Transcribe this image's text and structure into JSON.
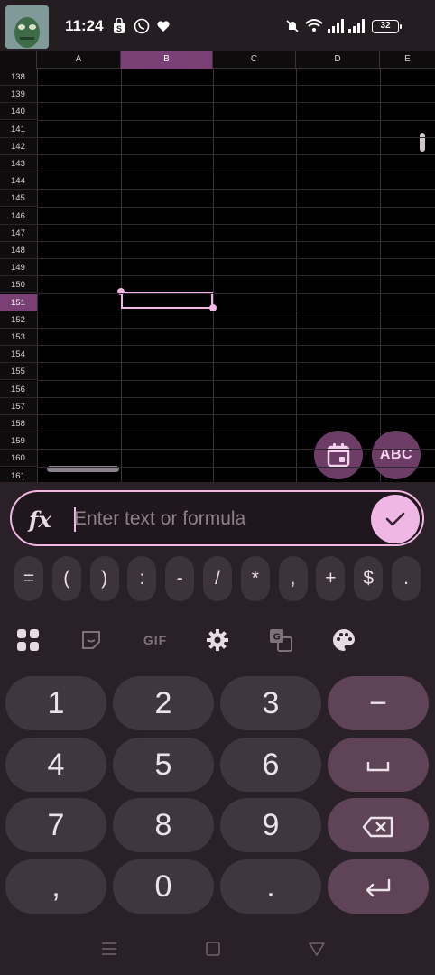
{
  "status_bar": {
    "time": "11:24",
    "battery": "32",
    "left_icons": [
      "shopping-bag-icon",
      "whatsapp-icon",
      "heart-shield-icon"
    ],
    "right_icons": [
      "mute-icon",
      "wifi-icon",
      "signal-icon",
      "signal-icon"
    ]
  },
  "sheet": {
    "columns": [
      "A",
      "B",
      "C",
      "D",
      "E"
    ],
    "selected_column": "B",
    "rows": [
      "138",
      "139",
      "140",
      "141",
      "142",
      "143",
      "144",
      "145",
      "146",
      "147",
      "148",
      "149",
      "150",
      "151",
      "152",
      "153",
      "154",
      "155",
      "156",
      "157",
      "158",
      "159",
      "160",
      "161"
    ],
    "selected_row": "151",
    "fabs": {
      "calendar_icon": "calendar-icon",
      "abc_label": "ABC"
    }
  },
  "formula_bar": {
    "fx_label": "fx",
    "placeholder": "Enter text or formula",
    "value": ""
  },
  "symbol_keys": [
    "=",
    "(",
    ")",
    ":",
    "-",
    "/",
    "*",
    ",",
    "+",
    "$",
    "."
  ],
  "toolbar": {
    "icons": [
      "apps-grid-icon",
      "sticker-icon",
      "gif-icon",
      "settings-icon",
      "translate-icon",
      "palette-icon"
    ],
    "gif_label": "GIF"
  },
  "numpad": {
    "rows": [
      [
        "1",
        "2",
        "3",
        "−"
      ],
      [
        "4",
        "5",
        "6",
        "␣"
      ],
      [
        "7",
        "8",
        "9",
        "backspace"
      ],
      [
        ",",
        "0",
        ".",
        "enter"
      ]
    ]
  },
  "nav_bar": {
    "icons": [
      "menu-icon",
      "home-icon",
      "back-icon"
    ]
  },
  "colors": {
    "accent": "#f0b7e4",
    "selection": "#7a3f74",
    "fn_key": "#5f4458",
    "key": "#40363f",
    "panel": "#2a2128"
  }
}
